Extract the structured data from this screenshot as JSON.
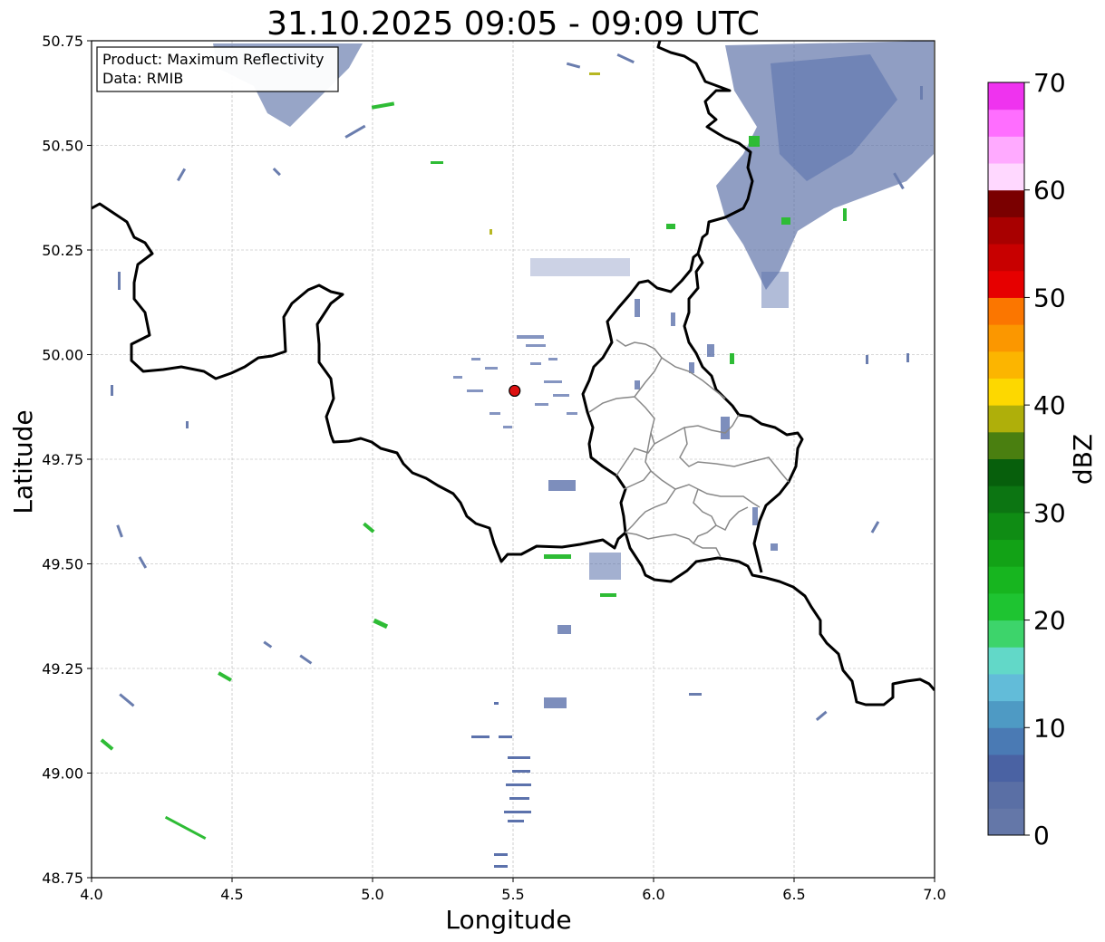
{
  "title": "31.10.2025 09:05 - 09:09 UTC",
  "info_box": {
    "line1": "Product: Maximum Reflectivity",
    "line2": "Data: RMIB"
  },
  "axes": {
    "xlabel": "Longitude",
    "ylabel": "Latitude",
    "xlim": [
      4.0,
      7.0
    ],
    "ylim": [
      48.75,
      50.75
    ],
    "xticks": [
      "4.0",
      "4.5",
      "5.0",
      "5.5",
      "6.0",
      "6.5",
      "7.0"
    ],
    "yticks": [
      "50.75",
      "50.50",
      "50.25",
      "50.00",
      "49.75",
      "49.50",
      "49.25",
      "49.00",
      "48.75"
    ],
    "grid": true
  },
  "colorbar": {
    "label": "dBZ",
    "ticks": [
      "0",
      "10",
      "20",
      "30",
      "40",
      "50",
      "60",
      "70"
    ],
    "colors": [
      "#6477a8",
      "#5a6fa5",
      "#4a62a3",
      "#4a7ab4",
      "#4e9ac4",
      "#62bcd9",
      "#62d8c8",
      "#3dd46b",
      "#1ec431",
      "#17b51f",
      "#12a216",
      "#0f8c14",
      "#0c7512",
      "#075f0c",
      "#4a7f10",
      "#afaf0a",
      "#fdd800",
      "#fcb500",
      "#fb9700",
      "#fb7600",
      "#e60000",
      "#c80000",
      "#a80000",
      "#7a0000",
      "#ffd8ff",
      "#ffaaff",
      "#ff6eff",
      "#ef33ef"
    ]
  },
  "radar_site": {
    "lon": 5.5056,
    "lat": 49.9136,
    "color": "#dd1111"
  }
}
